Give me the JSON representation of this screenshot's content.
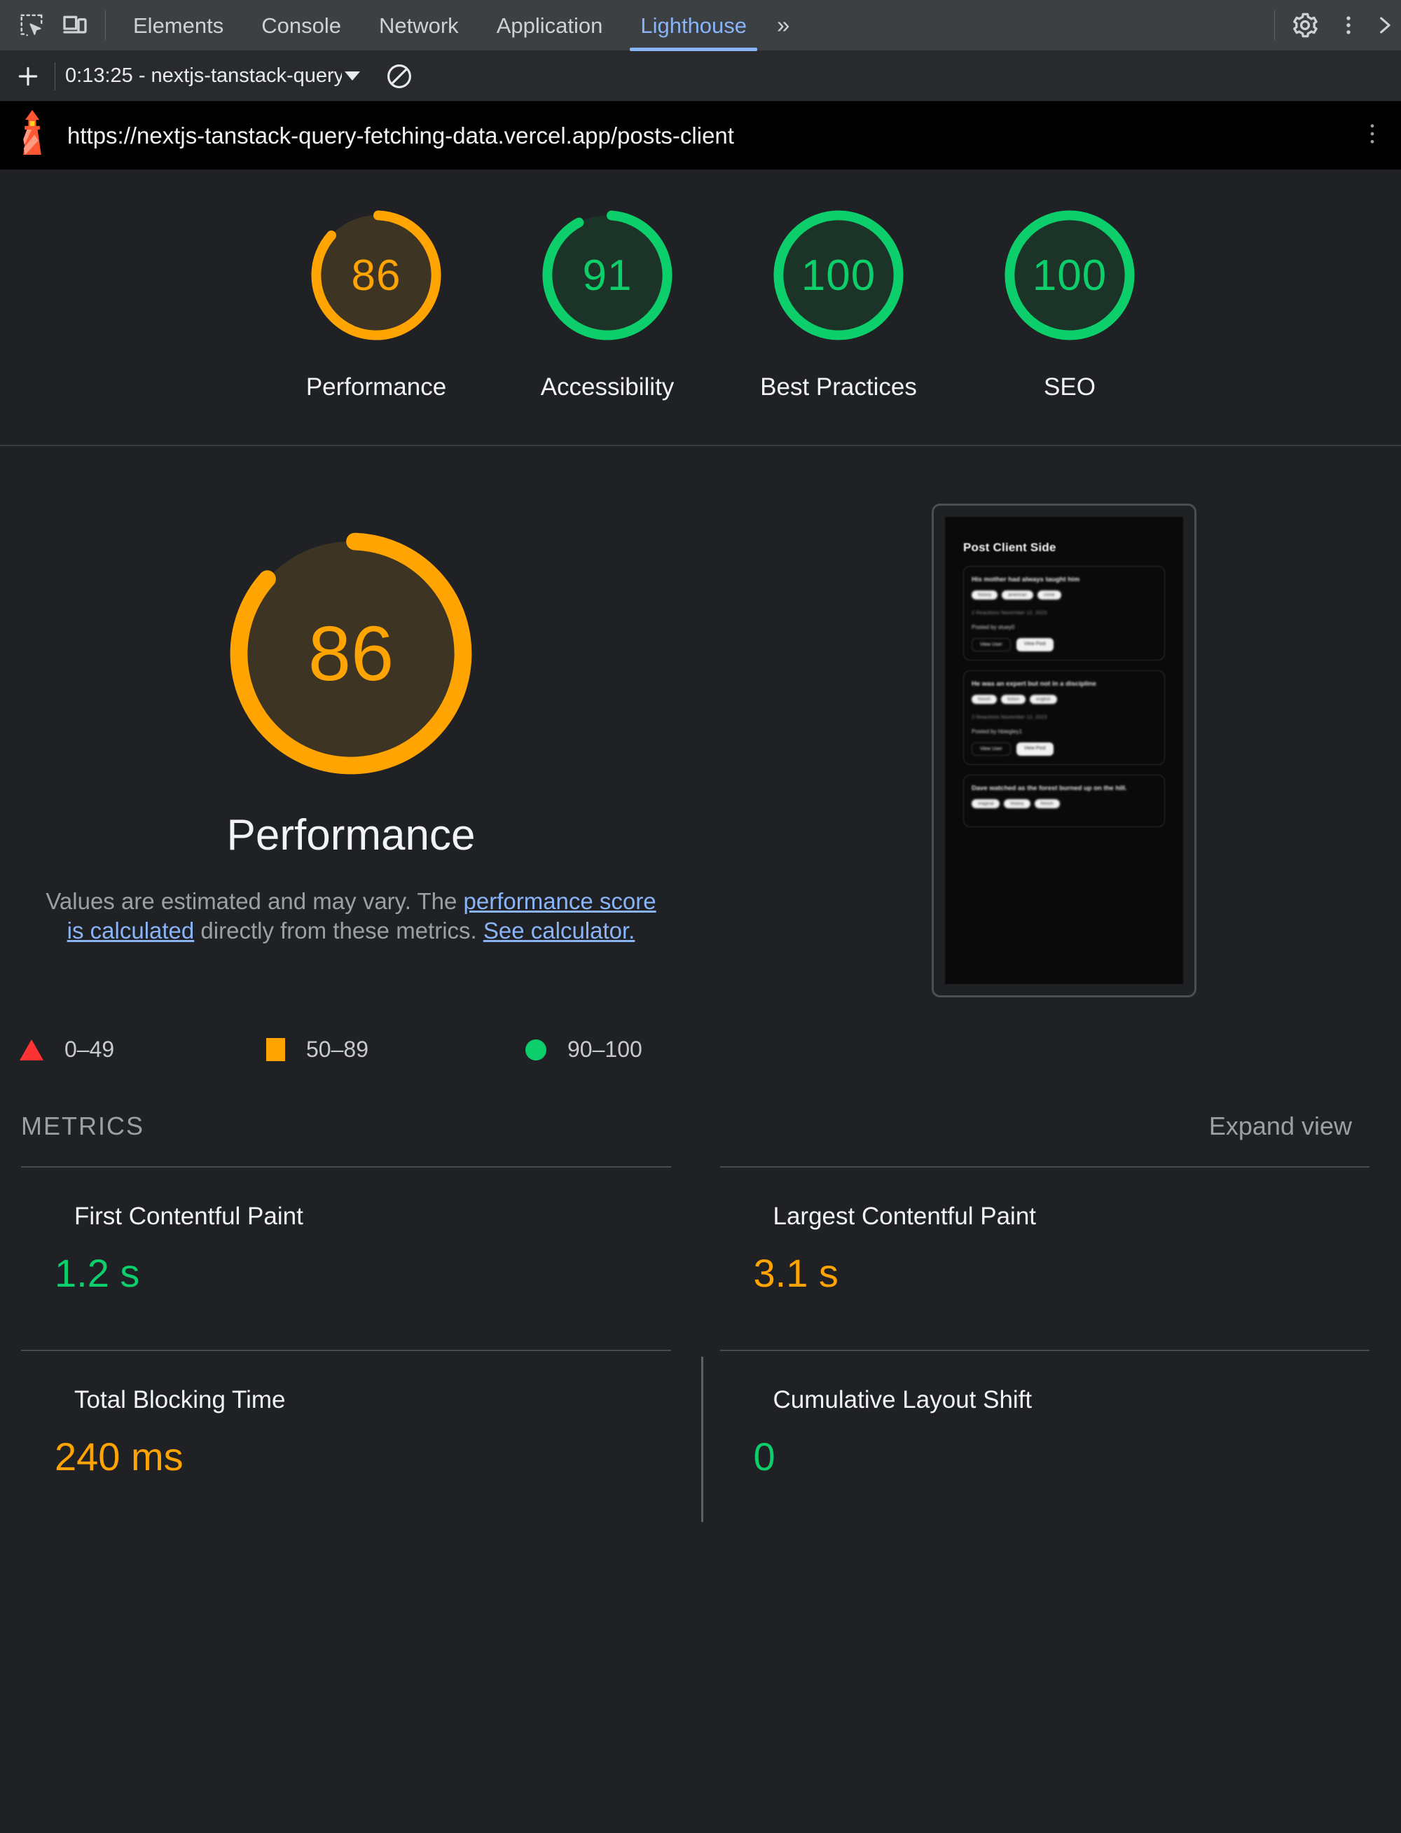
{
  "devtools": {
    "icons": {
      "inspect": "inspect-element-icon",
      "device": "device-toolbar-icon",
      "settings": "gear-icon",
      "kebab": "more-options-icon",
      "close": "close-panel-icon"
    },
    "tabs": [
      {
        "label": "Elements",
        "active": false
      },
      {
        "label": "Console",
        "active": false
      },
      {
        "label": "Network",
        "active": false
      },
      {
        "label": "Application",
        "active": false
      },
      {
        "label": "Lighthouse",
        "active": true
      }
    ],
    "more_tabs_label": "»"
  },
  "lh_toolbar": {
    "add_label": "+",
    "report_selector": "0:13:25 - nextjs-tanstack-query",
    "clear_label": "clear-icon"
  },
  "url_bar": {
    "logo": "lighthouse-logo-icon",
    "url": "https://nextjs-tanstack-query-fetching-data.vercel.app/posts-client",
    "kebab": "report-menu-icon"
  },
  "colors": {
    "pass": "#0cce6b",
    "average": "#ffa400",
    "fail": "#ff3333",
    "accent": "#8ab4f8"
  },
  "scores": [
    {
      "value": "86",
      "label": "Performance",
      "rating": "average"
    },
    {
      "value": "91",
      "label": "Accessibility",
      "rating": "pass"
    },
    {
      "value": "100",
      "label": "Best Practices",
      "rating": "pass"
    },
    {
      "value": "100",
      "label": "SEO",
      "rating": "pass"
    }
  ],
  "category": {
    "score": "86",
    "title": "Performance",
    "desc_part1": "Values are estimated and may vary. The ",
    "desc_link1": "performance score is calculated",
    "desc_part2": " directly from these metrics. ",
    "desc_link2": "See calculator."
  },
  "legend": [
    {
      "shape": "triangle",
      "range": "0–49"
    },
    {
      "shape": "square",
      "range": "50–89"
    },
    {
      "shape": "circle",
      "range": "90–100"
    }
  ],
  "metrics_section": {
    "title": "METRICS",
    "expand_label": "Expand view"
  },
  "metrics": [
    {
      "name": "First Contentful Paint",
      "value": "1.2 s",
      "rating": "pass"
    },
    {
      "name": "Largest Contentful Paint",
      "value": "3.1 s",
      "rating": "average"
    },
    {
      "name": "Total Blocking Time",
      "value": "240 ms",
      "rating": "average"
    },
    {
      "name": "Cumulative Layout Shift",
      "value": "0",
      "rating": "pass"
    }
  ],
  "thumbnail": {
    "title": "Post Client Side",
    "posts": [
      {
        "heading": "His mother had always taught him",
        "tags": [
          "history",
          "american",
          "crime"
        ],
        "meta": "2 Reactions    November 12, 2023",
        "by": "Posted by stuey0",
        "btn_ghost": "View User",
        "btn_solid": "View Post"
      },
      {
        "heading": "He was an expert but not in a discipline",
        "tags": [
          "french",
          "fiction",
          "english"
        ],
        "meta": "2 Reactions    November 12, 2023",
        "by": "Posted by hbiegley1",
        "btn_ghost": "View User",
        "btn_solid": "View Post"
      },
      {
        "heading": "Dave watched as the forest burned up on the hill.",
        "tags": [
          "magical",
          "history",
          "french"
        ],
        "meta": "",
        "by": "",
        "btn_ghost": "",
        "btn_solid": ""
      }
    ]
  }
}
